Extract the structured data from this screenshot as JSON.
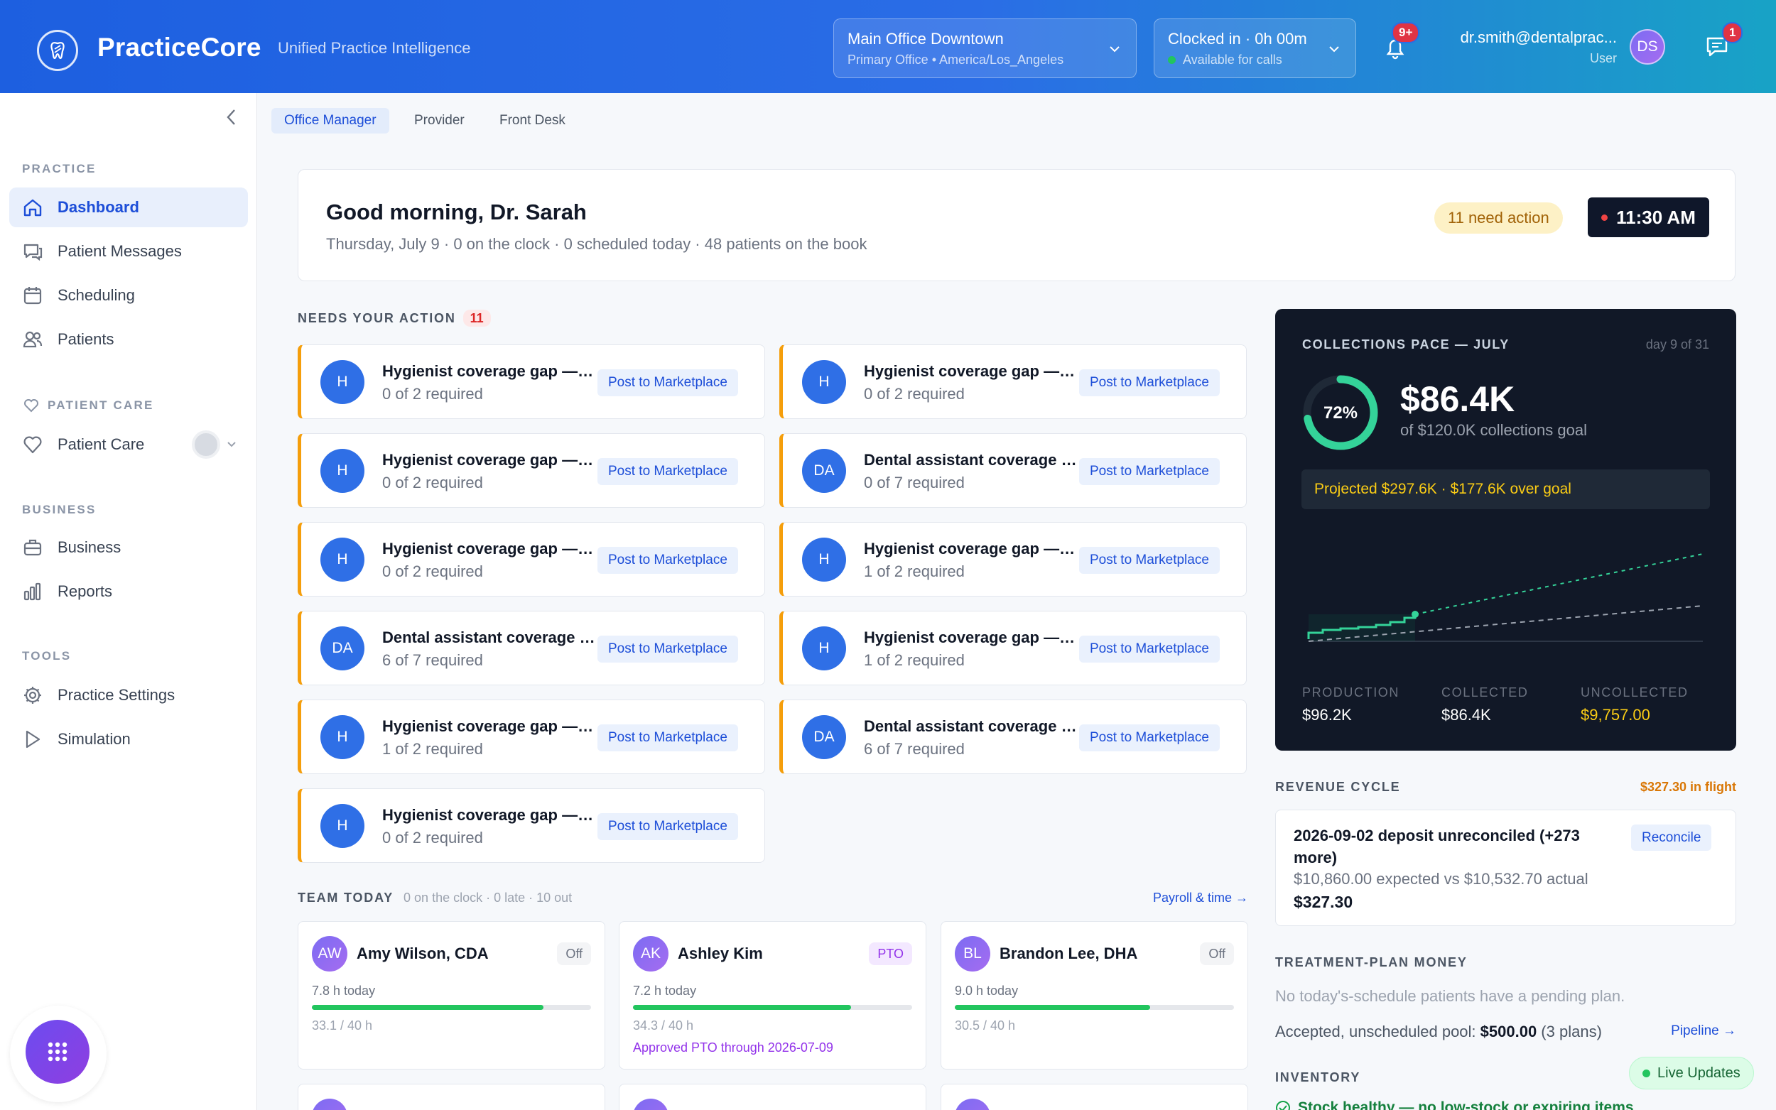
{
  "header": {
    "brand": "PracticeCore",
    "tagline": "Unified Practice Intelligence",
    "location_title": "Main Office Downtown",
    "location_sub": "Primary Office • America/Los_Angeles",
    "clock_title": "Clocked in · 0h 00m",
    "clock_sub": "Available for calls",
    "notif_badge": "9+",
    "user_email": "dr.smith@dentalprac...",
    "user_role": "User",
    "avatar": "DS",
    "chat_badge": "1"
  },
  "sidebar": {
    "sections": {
      "practice": "PRACTICE",
      "patient_care": "PATIENT CARE",
      "business": "BUSINESS",
      "tools": "TOOLS"
    },
    "items": {
      "dashboard": "Dashboard",
      "messages": "Patient Messages",
      "scheduling": "Scheduling",
      "patients": "Patients",
      "patient_care": "Patient Care",
      "business": "Business",
      "reports": "Reports",
      "settings": "Practice Settings",
      "simulation": "Simulation"
    }
  },
  "roles": [
    "Office Manager",
    "Provider",
    "Front Desk"
  ],
  "greeting": {
    "title": "Good morning, Dr. Sarah",
    "subtitle": "Thursday, July 9 · 0 on the clock · 0 scheduled today · 48 patients on the book",
    "need_action": "11 need action",
    "time": "11:30 AM"
  },
  "actions": {
    "label": "NEEDS YOUR ACTION",
    "count": "11",
    "button": "Post to Marketplace",
    "items": [
      {
        "avatar": "H",
        "title": "Hygienist coverage gap — Thursday",
        "req": "0 of 2 required"
      },
      {
        "avatar": "H",
        "title": "Hygienist coverage gap — Friday",
        "req": "0 of 2 required"
      },
      {
        "avatar": "H",
        "title": "Hygienist coverage gap — Monday",
        "req": "0 of 2 required"
      },
      {
        "avatar": "DA",
        "title": "Dental assistant coverage gap",
        "req": "0 of 7 required"
      },
      {
        "avatar": "H",
        "title": "Hygienist coverage gap — Tuesday",
        "req": "0 of 2 required"
      },
      {
        "avatar": "H",
        "title": "Hygienist coverage gap — Wednesday",
        "req": "1 of 2 required"
      },
      {
        "avatar": "DA",
        "title": "Dental assistant coverage gap",
        "req": "6 of 7 required"
      },
      {
        "avatar": "H",
        "title": "Hygienist coverage gap — Thursday",
        "req": "1 of 2 required"
      },
      {
        "avatar": "H",
        "title": "Hygienist coverage gap — Friday",
        "req": "1 of 2 required"
      },
      {
        "avatar": "DA",
        "title": "Dental assistant coverage gap",
        "req": "6 of 7 required"
      },
      {
        "avatar": "H",
        "title": "Hygienist coverage gap — Monday",
        "req": "0 of 2 required"
      }
    ]
  },
  "collections": {
    "label": "COLLECTIONS PACE — JULY",
    "day": "day 9 of 31",
    "percent": "72%",
    "percent_value": 0.72,
    "amount": "$86.4K",
    "goal": "of $120.0K collections goal",
    "projected": "Projected $297.6K · $177.6K over goal",
    "production_label": "PRODUCTION",
    "production": "$96.2K",
    "collected_label": "COLLECTED",
    "collected": "$86.4K",
    "uncollected_label": "UNCOLLECTED",
    "uncollected": "$9,757.00",
    "accent": "#34d399"
  },
  "revenue": {
    "label": "REVENUE CYCLE",
    "in_flight": "$327.30 in flight",
    "title": "2026-09-02 deposit unreconciled (+273 more)",
    "detail": "$10,860.00 expected vs $10,532.70 actual",
    "amount": "$327.30",
    "button": "Reconcile"
  },
  "treatment": {
    "label": "TREATMENT-PLAN MONEY",
    "empty": "No today's-schedule patients have a pending plan.",
    "pool_prefix": "Accepted, unscheduled pool: ",
    "pool_amount": "$500.00",
    "pool_suffix": " (3 plans)",
    "link": "Pipeline →"
  },
  "inventory": {
    "label": "INVENTORY",
    "status": "Stock healthy — no low-stock or expiring items"
  },
  "team": {
    "label": "TEAM TODAY",
    "summary": "0 on the clock · 0 late · 10 out",
    "link": "Payroll & time →",
    "members": [
      {
        "avatar": "AW",
        "name": "Amy Wilson, CDA",
        "tag": "Off",
        "today": "7.8 h today",
        "week": "33.1 / 40 h",
        "progress": 0.83,
        "note": ""
      },
      {
        "avatar": "AK",
        "name": "Ashley Kim",
        "tag": "PTO",
        "today": "7.2 h today",
        "week": "34.3 / 40 h",
        "progress": 0.78,
        "note": "Approved PTO through 2026-07-09"
      },
      {
        "avatar": "BL",
        "name": "Brandon Lee, DHA",
        "tag": "Off",
        "today": "9.0 h today",
        "week": "30.5 / 40 h",
        "progress": 0.7,
        "note": ""
      }
    ]
  },
  "live": "Live Updates"
}
